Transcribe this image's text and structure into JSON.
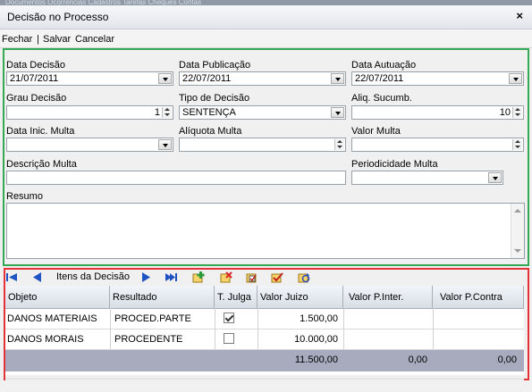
{
  "window": {
    "title": "Decisão no Processo",
    "close_glyph": "×"
  },
  "background_tabs": "Documentos   Ocorrências   Cadastros   Tarefas   Cheques   Contas",
  "menu": {
    "fechar": "Fechar",
    "sep": "|",
    "salvar": "Salvar",
    "cancelar": "Cancelar"
  },
  "form": {
    "data_decisao": {
      "label": "Data Decisão",
      "value": "21/07/2011"
    },
    "data_publicacao": {
      "label": "Data Publicação",
      "value": "22/07/2011"
    },
    "data_autuacao": {
      "label": "Data Autuação",
      "value": "22/07/2011"
    },
    "grau_decisao": {
      "label": "Grau Decisão",
      "value": "1"
    },
    "tipo_decisao": {
      "label": "Tipo de Decisão",
      "value": "SENTENÇA"
    },
    "aliq_sucumb": {
      "label": "Aliq. Sucumb.",
      "value": "10"
    },
    "data_inic_multa": {
      "label": "Data Inic. Multa",
      "value": ""
    },
    "aliquota_multa": {
      "label": "Alíquota Multa",
      "value": ""
    },
    "valor_multa": {
      "label": "Valor Multa",
      "value": ""
    },
    "descricao_multa": {
      "label": "Descrição Multa",
      "value": ""
    },
    "periodicidade_multa": {
      "label": "Periodicidade Multa",
      "value": ""
    },
    "resumo": {
      "label": "Resumo",
      "value": ""
    }
  },
  "navigator": {
    "label": "Itens da Decisão",
    "icons": [
      "first-icon",
      "prev-icon",
      "next-icon",
      "last-icon",
      "insert-icon",
      "delete-icon",
      "edit-icon",
      "post-icon",
      "refresh-icon"
    ]
  },
  "grid": {
    "headers": [
      "Objeto",
      "Resultado",
      "T. Julga",
      "Valor Juizo",
      "Valor P.Inter.",
      "Valor P.Contra"
    ],
    "rows": [
      {
        "objeto": "DANOS MATERIAIS",
        "resultado": "PROCED.PARTE",
        "julgado": true,
        "valor_juizo": "1.500,00",
        "valor_p_inter": "",
        "valor_p_contra": ""
      },
      {
        "objeto": "DANOS MORAIS",
        "resultado": "PROCEDENTE",
        "julgado": false,
        "valor_juizo": "10.000,00",
        "valor_p_inter": "",
        "valor_p_contra": ""
      }
    ],
    "totals": {
      "valor_juizo": "11.500,00",
      "valor_p_inter": "0,00",
      "valor_p_contra": "0,00"
    }
  },
  "colors": {
    "highlight_green": "#34a853",
    "highlight_red": "#e53238",
    "footer_bg": "#a7abbd"
  }
}
